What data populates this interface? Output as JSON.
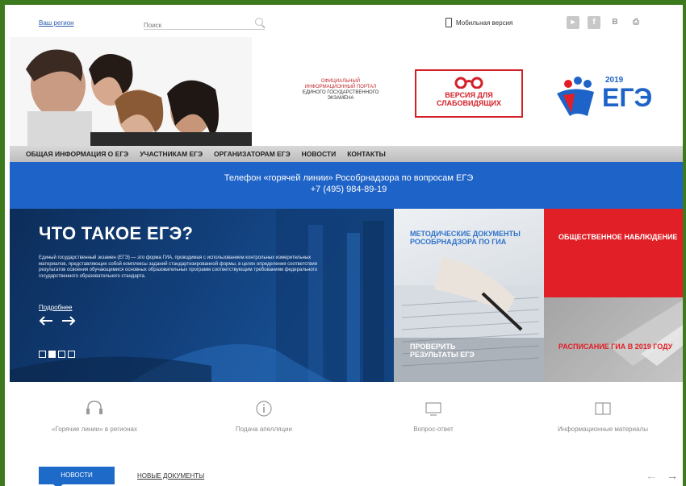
{
  "topbar": {
    "region_link": "Ваш регион",
    "search_placeholder": "Поиск",
    "mobile_version": "Мобильная версия",
    "socials": [
      "youtube-icon",
      "facebook-icon",
      "vk-icon",
      "print-icon"
    ]
  },
  "header": {
    "portal_line1": "ОФИЦИАЛЬНЫЙ",
    "portal_line2": "ИНФОРМАЦИОННЫЙ ПОРТАЛ",
    "portal_line3": "ЕДИНОГО ГОСУДАРСТВЕННОГО",
    "portal_line4": "ЭКЗАМЕНА",
    "visually_line1": "ВЕРСИЯ ДЛЯ",
    "visually_line2": "СЛАБОВИДЯЩИХ",
    "logo_year": "2019",
    "logo_text": "ЕГЭ"
  },
  "nav": {
    "items": [
      "ОБЩАЯ ИНФОРМАЦИЯ О ЕГЭ",
      "УЧАСТНИКАМ ЕГЭ",
      "ОРГАНИЗАТОРАМ ЕГЭ",
      "НОВОСТИ",
      "КОНТАКТЫ"
    ]
  },
  "hotline": {
    "line1": "Телефон «горячей линии» Рособрнадзора по вопросам ЕГЭ",
    "line2": "+7 (495) 984-89-19"
  },
  "slider": {
    "title": "ЧТО ТАКОЕ ЕГЭ?",
    "text": "Единый государственный экзамен (ЕГЭ) — это форма ГИА, проводимая с использованием контрольных измерительных материалов, представляющих собой комплексы заданий стандартизированной формы, в целях определения соответствия результатов освоения обучающимися основных образовательных программ соответствующим требованиям федерального государственного образовательного стандарта.",
    "more_link": "Подробнее",
    "slides_total": 4,
    "active_slide": 2
  },
  "tiles": {
    "methodical": "МЕТОДИЧЕСКИЕ ДОКУМЕНТЫ РОСОБРНАДЗОРА ПО ГИА",
    "check_results": "ПРОВЕРИТЬ РЕЗУЛЬТАТЫ ЕГЭ",
    "observation": "ОБЩЕСТВЕННОЕ НАБЛЮДЕНИЕ",
    "schedule": "РАСПИСАНИЕ ГИА В 2019 ГОДУ"
  },
  "services": [
    {
      "icon": "headset-icon",
      "label": "«Горячие линии» в регионах"
    },
    {
      "icon": "info-icon",
      "label": "Подача апелляции"
    },
    {
      "icon": "monitor-icon",
      "label": "Вопрос-ответ"
    },
    {
      "icon": "book-icon",
      "label": "Информационные материалы"
    }
  ],
  "news_tabs": {
    "news": "НОВОСТИ",
    "documents": "НОВЫЕ ДОКУМЕНТЫ",
    "prev": "←",
    "next": "→"
  },
  "colors": {
    "frame": "#3d7a1e",
    "hotline_bg": "#1e63c7",
    "accent_red": "#e11f26",
    "link_blue": "#2b5aa8"
  }
}
